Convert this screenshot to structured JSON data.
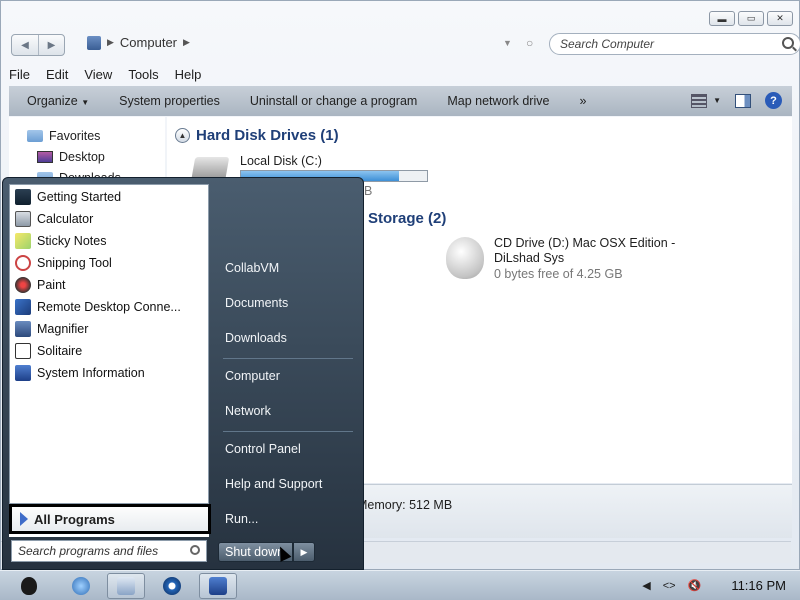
{
  "window": {
    "breadcrumb": "Computer",
    "search_placeholder": "Search Computer",
    "controls": {
      "minimize": "▬",
      "maximize": "▭",
      "close": "✕"
    }
  },
  "menubar": [
    "File",
    "Edit",
    "View",
    "Tools",
    "Help"
  ],
  "toolbar": {
    "organize": "Organize",
    "system_properties": "System properties",
    "uninstall": "Uninstall or change a program",
    "map_drive": "Map network drive",
    "more": "»"
  },
  "navpane": {
    "favorites": "Favorites",
    "desktop": "Desktop",
    "downloads": "Downloads"
  },
  "content": {
    "hdd_group": "Hard Disk Drives (1)",
    "local_disk": "Local Disk (C:)",
    "local_disk_usage_fraction": 0.85,
    "local_disk_free_partial": "B",
    "removable_group_partial": "Storage (2)",
    "cd_drive_name": "CD Drive (D:) Mac OSX Edition - DiLshad Sys",
    "cd_drive_free": "0 bytes free of 4.25 GB"
  },
  "details": {
    "memory_text": "Memory: 512 MB"
  },
  "startmenu": {
    "programs": [
      "Getting Started",
      "Calculator",
      "Sticky Notes",
      "Snipping Tool",
      "Paint",
      "Remote Desktop Conne...",
      "Magnifier",
      "Solitaire",
      "System Information"
    ],
    "all_programs": "All Programs",
    "search_placeholder": "Search programs and files",
    "right_items": [
      "CollabVM",
      "Documents",
      "Downloads",
      "Computer",
      "Network",
      "Control Panel",
      "Help and Support",
      "Run..."
    ],
    "shutdown": "Shut down"
  },
  "taskbar": {
    "clock": "11:16 PM"
  },
  "colors": {
    "group_heading": "#1f3f78",
    "start_menu_bg": "#3a4b5c",
    "progress": "#3d8fd6"
  }
}
